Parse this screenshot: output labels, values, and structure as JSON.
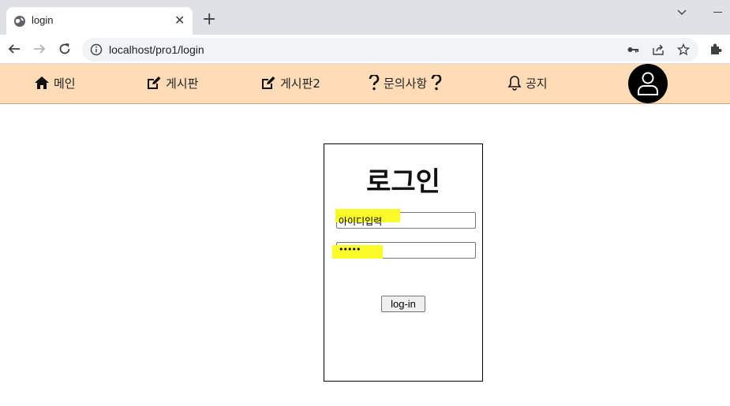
{
  "browser": {
    "tab_title": "login",
    "new_tab_label": "+",
    "close_label": "✕",
    "url": "localhost/pro1/login"
  },
  "navbar": {
    "items": [
      {
        "label": "메인",
        "icon": "home-icon"
      },
      {
        "label": "게시판",
        "icon": "edit-icon"
      },
      {
        "label": "게시판2",
        "icon": "edit-icon"
      },
      {
        "label": "문의사항",
        "icon": "question-icon"
      },
      {
        "label": "공지",
        "icon": "bell-icon"
      }
    ],
    "profile_icon": "user-icon",
    "background": "#ffdbb8"
  },
  "login": {
    "title": "로그인",
    "id_value": "아이디입력",
    "password_value": "•••••",
    "button_label": "log-in",
    "highlight_color": "#fbfb2a"
  }
}
